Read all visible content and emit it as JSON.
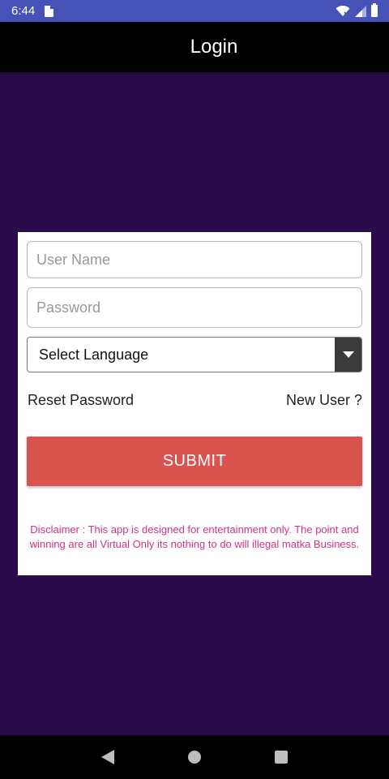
{
  "status_bar": {
    "time": "6:44"
  },
  "app_bar": {
    "title": "Login"
  },
  "form": {
    "username_placeholder": "User Name",
    "password_placeholder": "Password",
    "language_select": "Select Language",
    "reset_password": "Reset Password",
    "new_user": "New User ?",
    "submit": "SUBMIT",
    "disclaimer": "Disclaimer : This app is designed for entertainment only. The point and winning are all Virtual Only its nothing to do will illegal matka Business."
  },
  "colors": {
    "background": "#2a0a4a",
    "status_bar": "#4552b8",
    "submit": "#d9534f",
    "disclaimer": "#d63384"
  }
}
